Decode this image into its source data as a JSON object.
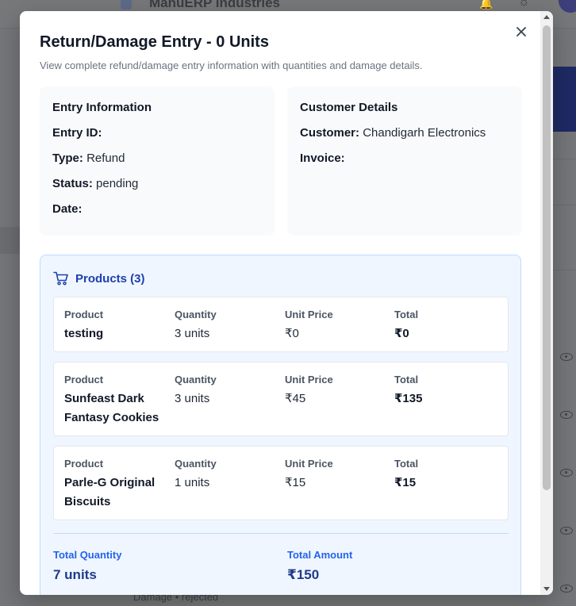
{
  "background": {
    "app_title": "ManuERP Industries",
    "footer_text": "Damage • rejected"
  },
  "modal": {
    "title": "Return/Damage Entry - 0 Units",
    "description": "View complete refund/damage entry information with quantities and damage details.",
    "entry_info": {
      "heading": "Entry Information",
      "entry_id_label": "Entry ID:",
      "entry_id_value": "",
      "type_label": "Type:",
      "type_value": "Refund",
      "status_label": "Status:",
      "status_value": "pending",
      "date_label": "Date:",
      "date_value": ""
    },
    "customer_details": {
      "heading": "Customer Details",
      "customer_label": "Customer:",
      "customer_value": "Chandigarh Electronics",
      "invoice_label": "Invoice:",
      "invoice_value": ""
    },
    "products": {
      "heading": "Products (3)",
      "column_headers": {
        "product": "Product",
        "quantity": "Quantity",
        "unit_price": "Unit Price",
        "total": "Total"
      },
      "items": [
        {
          "product": "testing",
          "quantity": "3 units",
          "unit_price": "₹0",
          "total": "₹0"
        },
        {
          "product": "Sunfeast Dark Fantasy Cookies",
          "quantity": "3 units",
          "unit_price": "₹45",
          "total": "₹135"
        },
        {
          "product": "Parle-G Original Biscuits",
          "quantity": "1 units",
          "unit_price": "₹15",
          "total": "₹15"
        }
      ],
      "total_quantity_label": "Total Quantity",
      "total_quantity_value": "7 units",
      "total_amount_label": "Total Amount",
      "total_amount_value": "₹150"
    }
  },
  "colors": {
    "accent_blue": "#1e40af",
    "panel_blue": "#eff6ff",
    "card_gray": "#f9fafb"
  }
}
